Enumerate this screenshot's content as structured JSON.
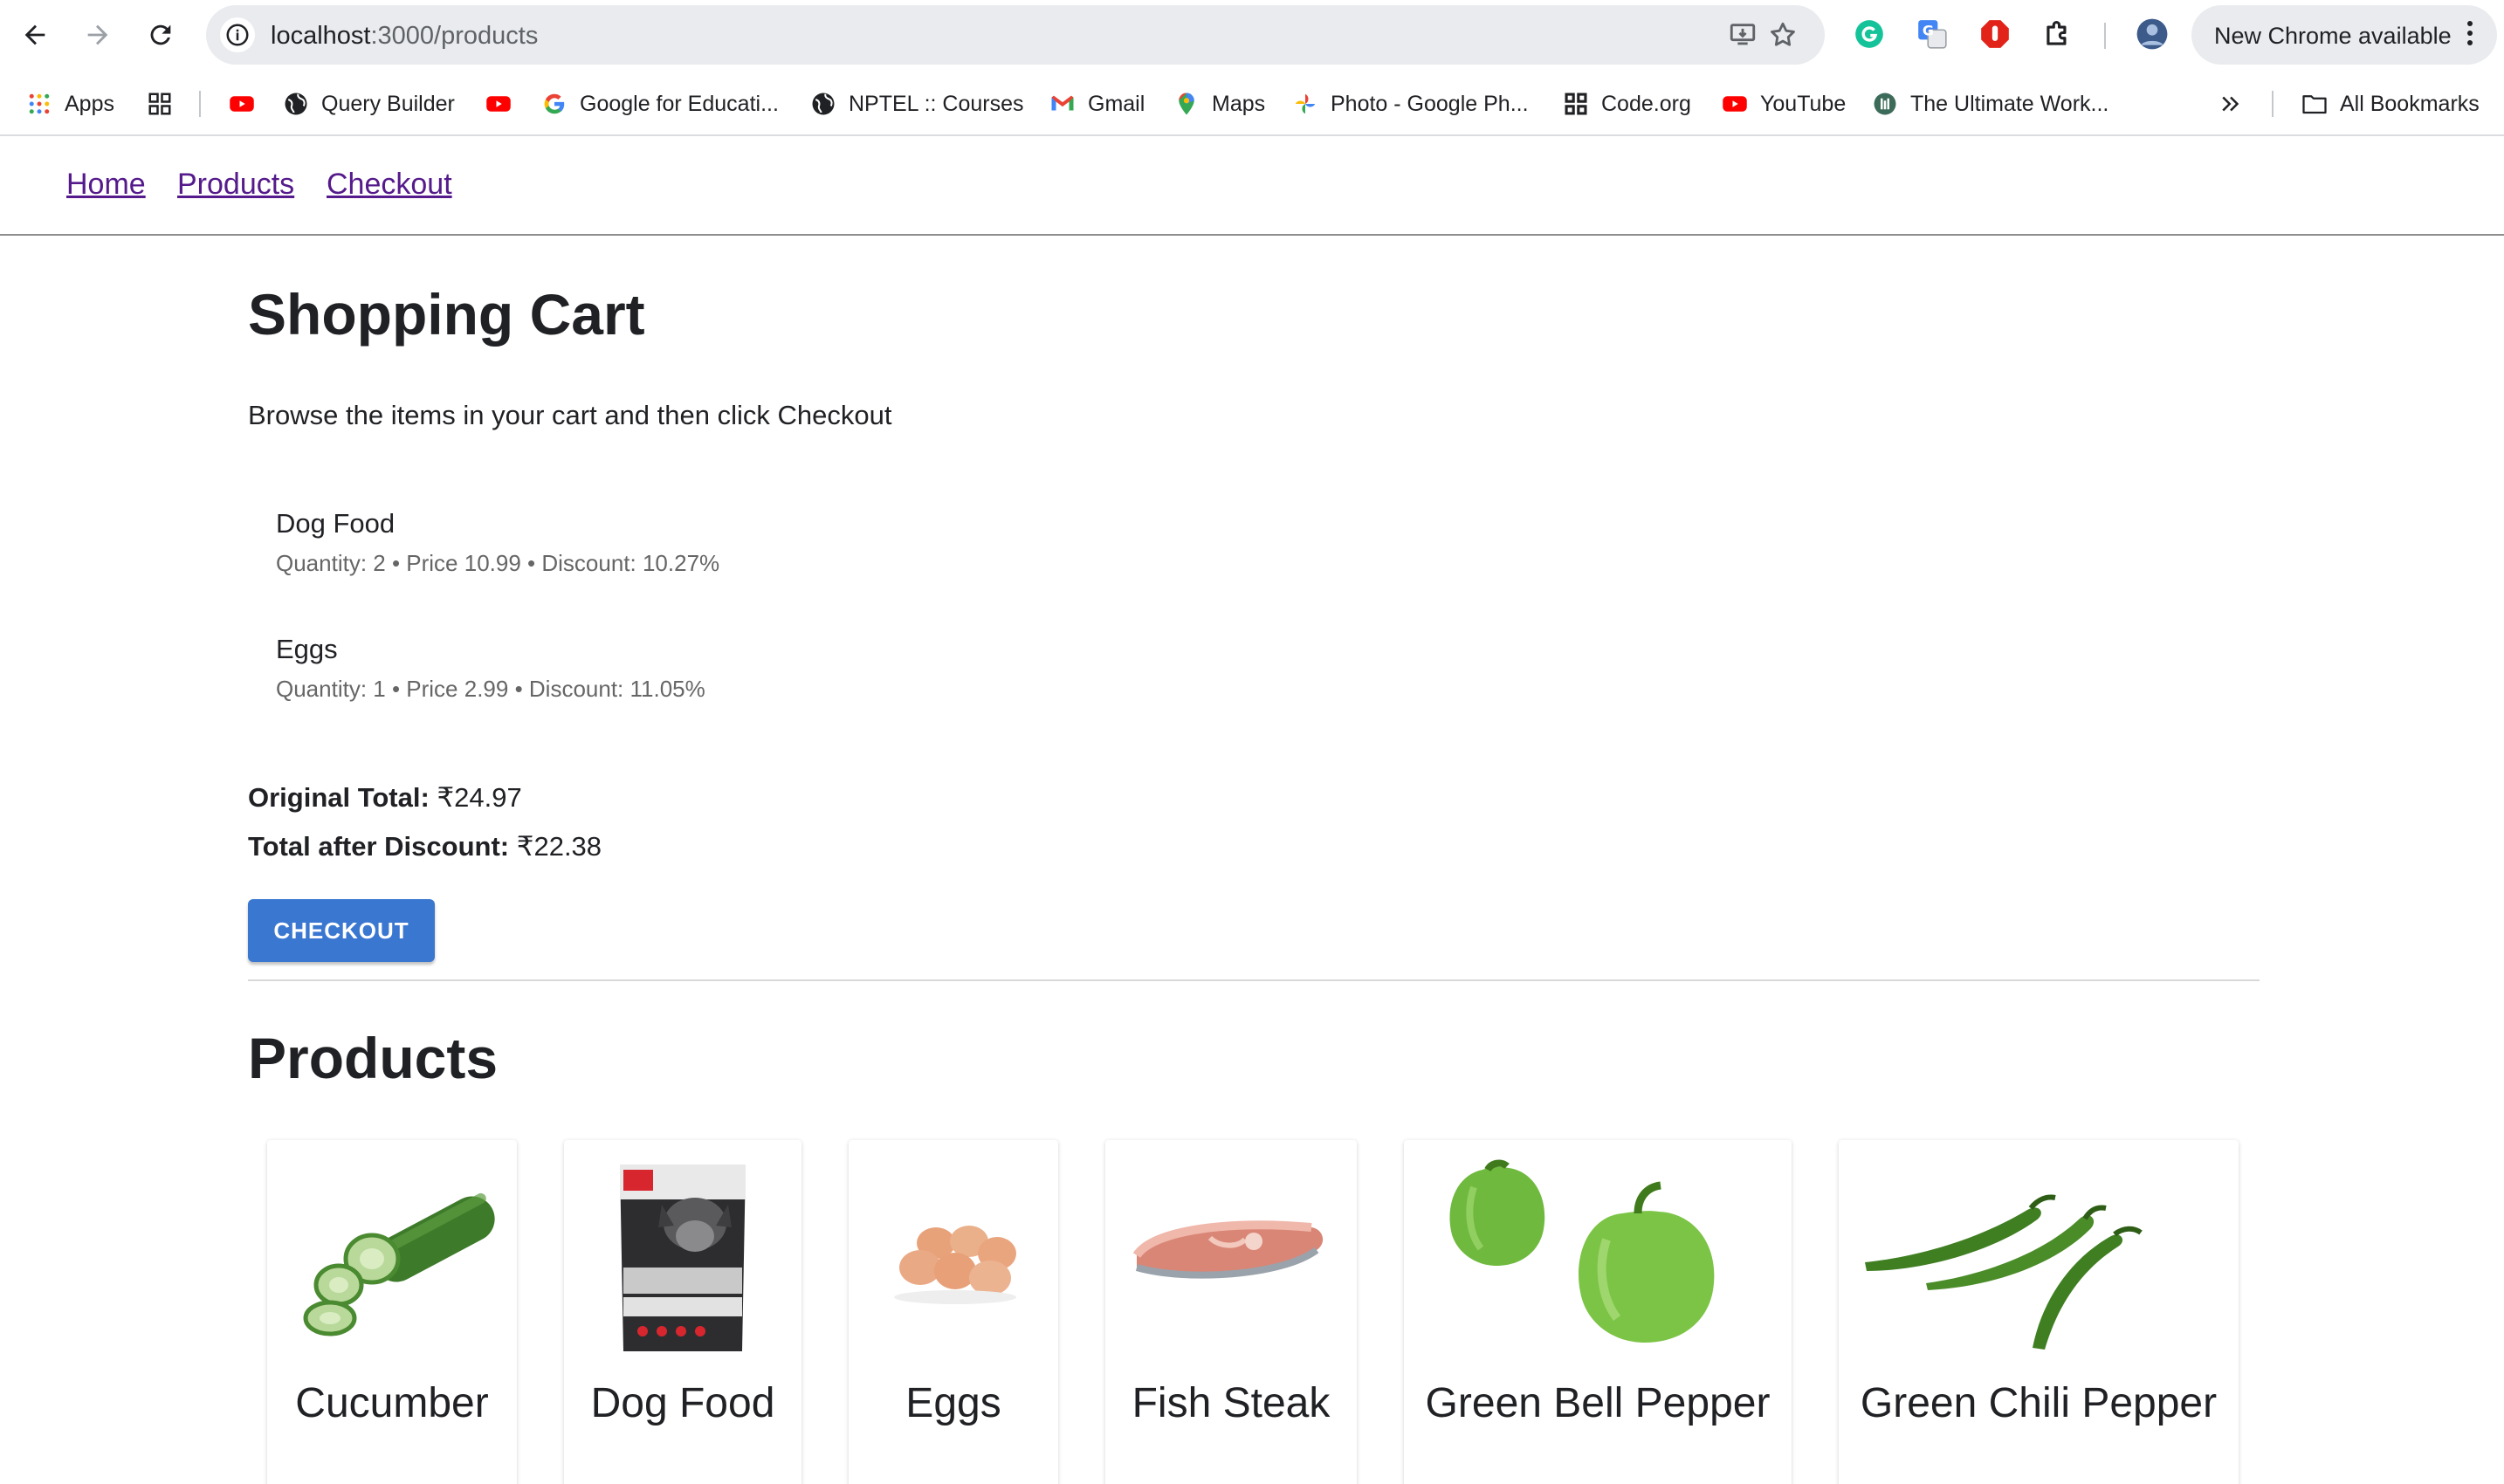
{
  "browser": {
    "url_host": "localhost",
    "url_path": ":3000/products",
    "update_button": "New Chrome available"
  },
  "bookmarks": [
    {
      "label": "Apps",
      "icon": "apps-grid-icon"
    },
    {
      "label": "",
      "icon": "qr-grid-icon"
    },
    {
      "label": "",
      "icon": "youtube-icon"
    },
    {
      "label": "Query Builder",
      "icon": "globe-icon"
    },
    {
      "label": "",
      "icon": "youtube-icon"
    },
    {
      "label": "Google for Educati...",
      "icon": "google-icon"
    },
    {
      "label": "NPTEL :: Courses",
      "icon": "globe-icon"
    },
    {
      "label": "Gmail",
      "icon": "gmail-icon"
    },
    {
      "label": "Maps",
      "icon": "maps-icon"
    },
    {
      "label": "Photo - Google Ph...",
      "icon": "photos-icon"
    },
    {
      "label": "Code.org",
      "icon": "code-org-icon"
    },
    {
      "label": "YouTube",
      "icon": "youtube-icon"
    },
    {
      "label": "The Ultimate Work...",
      "icon": "workspace-icon"
    },
    {
      "label": "All Bookmarks",
      "icon": "folder-icon"
    }
  ],
  "nav": {
    "home": "Home",
    "products": "Products",
    "checkout": "Checkout"
  },
  "cart": {
    "title": "Shopping Cart",
    "intro": "Browse the items in your cart and then click Checkout",
    "items": [
      {
        "name": "Dog Food",
        "meta": "Quantity: 2 • Price 10.99 • Discount: 10.27%"
      },
      {
        "name": "Eggs",
        "meta": "Quantity: 1 • Price 2.99 • Discount: 11.05%"
      }
    ],
    "original_total_label": "Original Total:",
    "original_total_value": "₹24.97",
    "discount_total_label": "Total after Discount:",
    "discount_total_value": "₹22.38",
    "checkout_button": "CHECKOUT"
  },
  "products": {
    "title": "Products",
    "items": [
      {
        "name": "Cucumber"
      },
      {
        "name": "Dog Food"
      },
      {
        "name": "Eggs"
      },
      {
        "name": "Fish Steak"
      },
      {
        "name": "Green Bell Pepper"
      },
      {
        "name": "Green Chili Pepper"
      }
    ]
  },
  "colors": {
    "link": "#551a8b",
    "button": "#3a77d1",
    "muted_text": "#666666"
  }
}
